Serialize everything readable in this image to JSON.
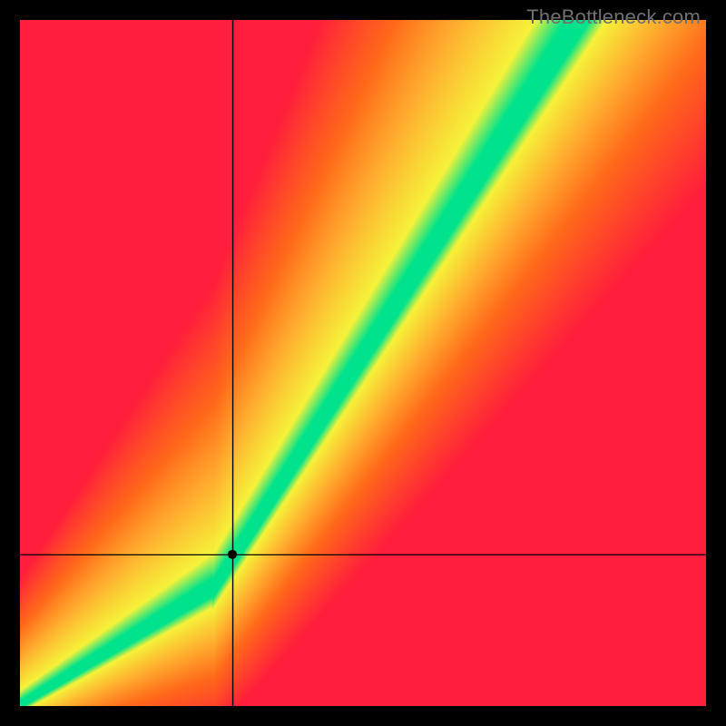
{
  "watermark": "TheBottleneck.com",
  "chart_data": {
    "type": "heatmap",
    "title": "",
    "xlabel": "",
    "ylabel": "",
    "xlim": [
      0,
      100
    ],
    "ylim": [
      0,
      100
    ],
    "grid": false,
    "optimal_curve_description": "Green band marks the optimal pairing; the ideal y grows roughly y ≈ 0.6·x for x<28 then steepens to y ≈ 1.55·x − 27 for x≥28. Distance from this curve maps through green→yellow→orange→red.",
    "crosshair": {
      "x": 31,
      "y": 22
    },
    "marker": {
      "x": 31,
      "y": 22
    },
    "color_stops": {
      "on_curve": "#00E38C",
      "near": "#F6F23A",
      "mid": "#FFB030",
      "far": "#FF6A1A",
      "very_far": "#FF1E3C"
    }
  }
}
